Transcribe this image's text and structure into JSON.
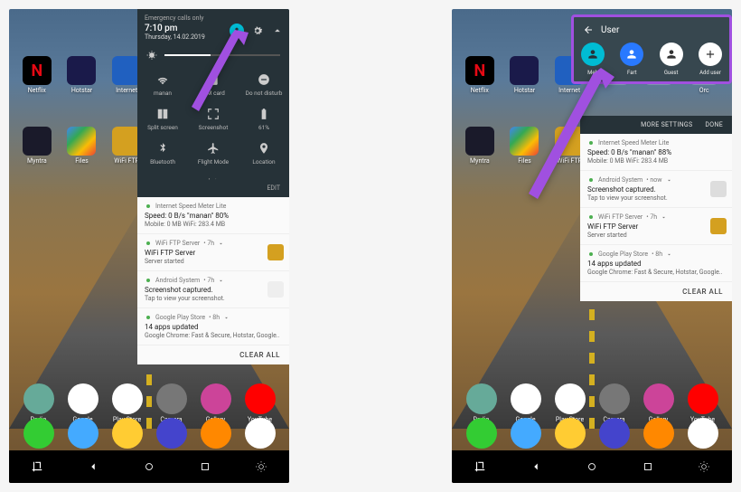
{
  "left": {
    "status": {
      "emergency": "Emergency calls only",
      "time": "7:10 pm",
      "date": "Thursday, 14.02.2019"
    },
    "home_apps_row1": [
      "Netflix",
      "Hotstar",
      "Internet",
      "",
      "",
      ""
    ],
    "home_apps_row2": [
      "Myntra",
      "Files",
      "WiFi FTP",
      "",
      "",
      ""
    ],
    "qs_tiles": [
      {
        "icon": "wifi",
        "label": "manan"
      },
      {
        "icon": "sim",
        "label": "SIM card"
      },
      {
        "icon": "dnd",
        "label": "Do not disturb"
      },
      {
        "icon": "split",
        "label": "Split screen"
      },
      {
        "icon": "screenshot",
        "label": "Screenshot"
      },
      {
        "icon": "battery",
        "label": "61%"
      },
      {
        "icon": "bluetooth",
        "label": "Bluetooth"
      },
      {
        "icon": "airplane",
        "label": "Flight Mode"
      },
      {
        "icon": "location",
        "label": "Location"
      }
    ],
    "edit_label": "EDIT",
    "notifications": [
      {
        "app": "Internet Speed Meter Lite",
        "time": "",
        "title": "Speed: 0 B/s   \"manan\" 80%",
        "body": "Mobile: 0 MB   WiFi: 283.4 MB",
        "icon_color": ""
      },
      {
        "app": "WiFi FTP Server",
        "time": "7h",
        "title": "WiFi FTP Server",
        "body": "Server started",
        "icon_color": "#d4a020"
      },
      {
        "app": "Android System",
        "time": "7h",
        "title": "Screenshot captured.",
        "body": "Tap to view your screenshot.",
        "icon_color": "#eee"
      },
      {
        "app": "Google Play Store",
        "time": "8h",
        "title": "14 apps updated",
        "body": "Google Chrome: Fast & Secure, Hotstar, Google..",
        "icon_color": ""
      }
    ],
    "clear_all": "CLEAR ALL",
    "dock_row1": [
      "Radio",
      "Google",
      "Play Store",
      "Camera",
      "Gallery",
      "YouTube"
    ]
  },
  "right": {
    "user_panel": {
      "title": "User",
      "users": [
        {
          "name": "Meh",
          "fg": "#263238",
          "bg": "#00bcd4"
        },
        {
          "name": "Fart",
          "fg": "#fff",
          "bg": "#2979ff"
        },
        {
          "name": "Guest",
          "fg": "#333",
          "bg": "#fff"
        },
        {
          "name": "Add user",
          "fg": "#333",
          "bg": "#fff",
          "plus": true
        }
      ]
    },
    "more_settings": "MORE SETTINGS",
    "done": "DONE",
    "home_apps_row1": [
      "Netflix",
      "Hotstar",
      "Internet",
      "",
      "",
      "Orc"
    ],
    "home_apps_row2": [
      "Myntra",
      "Files",
      "WiFi FTP",
      "",
      "",
      ""
    ],
    "notifications": [
      {
        "app": "Internet Speed Meter Lite",
        "time": "",
        "title": "Speed: 0 B/s   \"manan\" 88%",
        "body": "Mobile: 0 MB   WiFi: 283.4 MB",
        "icon_color": ""
      },
      {
        "app": "Android System",
        "time": "now",
        "title": "Screenshot captured.",
        "body": "Tap to view your screenshot.",
        "icon_color": "#ddd"
      },
      {
        "app": "WiFi FTP Server",
        "time": "7h",
        "title": "WiFi FTP Server",
        "body": "Server started",
        "icon_color": "#d4a020"
      },
      {
        "app": "Google Play Store",
        "time": "8h",
        "title": "14 apps updated",
        "body": "Google Chrome: Fast & Secure, Hotstar, Google..",
        "icon_color": ""
      }
    ],
    "clear_all": "CLEAR ALL",
    "dock_row1": [
      "Radio",
      "Google",
      "Play Store",
      "Camera",
      "Gallery",
      "YouTube"
    ]
  }
}
